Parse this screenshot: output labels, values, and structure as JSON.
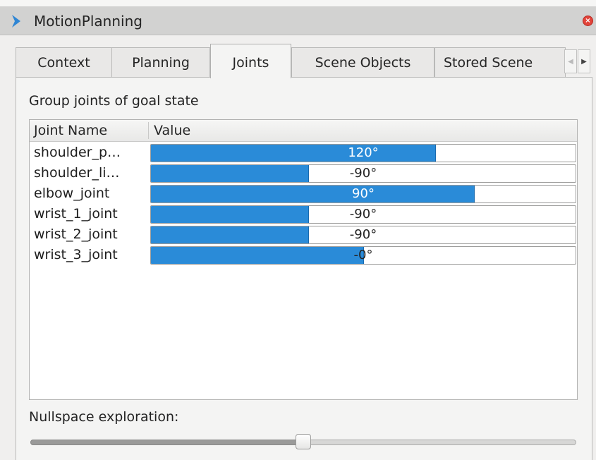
{
  "window": {
    "title": "MotionPlanning",
    "title_icon": "chevron-right-icon",
    "close_icon": "close-icon"
  },
  "tabs": [
    {
      "label": "Context",
      "active": false
    },
    {
      "label": "Planning",
      "active": false
    },
    {
      "label": "Joints",
      "active": true
    },
    {
      "label": "Scene Objects",
      "active": false
    },
    {
      "label": "Stored Scene",
      "active": false
    }
  ],
  "tab_scroll": {
    "left_icon": "arrow-left-icon",
    "right_icon": "arrow-right-icon"
  },
  "joints_panel": {
    "group_label": "Group joints of goal state",
    "table": {
      "headers": [
        "Joint Name",
        "Value"
      ],
      "rows": [
        {
          "name": "shoulder_p…",
          "value": "120°",
          "fill_fraction": 0.67
        },
        {
          "name": "shoulder_li…",
          "value": "-90°",
          "fill_fraction": 0.37
        },
        {
          "name": "elbow_joint",
          "value": "90°",
          "fill_fraction": 0.76
        },
        {
          "name": "wrist_1_joint",
          "value": "-90°",
          "fill_fraction": 0.37
        },
        {
          "name": "wrist_2_joint",
          "value": "-90°",
          "fill_fraction": 0.37
        },
        {
          "name": "wrist_3_joint",
          "value": "-0°",
          "fill_fraction": 0.5
        }
      ]
    },
    "nullspace_label": "Nullspace exploration:",
    "nullspace_slider_fraction": 0.5
  },
  "colors": {
    "bar_fill": "#2a8bd8",
    "close_button": "#e2443a",
    "title_icon": "#2f86d4"
  }
}
